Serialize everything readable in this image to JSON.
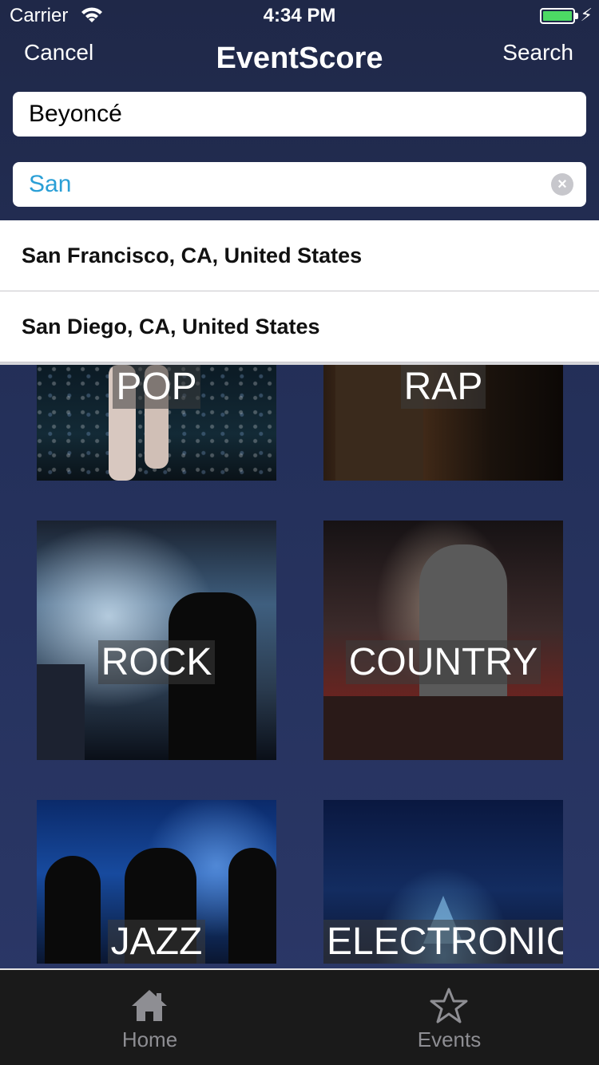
{
  "status_bar": {
    "carrier": "Carrier",
    "time": "4:34 PM",
    "battery_color": "#4cd964"
  },
  "nav": {
    "cancel_label": "Cancel",
    "title": "EventScore",
    "search_label": "Search"
  },
  "search": {
    "artist_value": "Beyoncé",
    "location_value": "San",
    "location_text_color": "#2a9fd6"
  },
  "suggestions": [
    {
      "label": "San Francisco, CA, United States"
    },
    {
      "label": "San Diego, CA, United States"
    }
  ],
  "genres": [
    {
      "label": "POP"
    },
    {
      "label": "RAP"
    },
    {
      "label": "ROCK"
    },
    {
      "label": "COUNTRY"
    },
    {
      "label": "JAZZ"
    },
    {
      "label": "ELECTRONIC"
    }
  ],
  "tab_bar": {
    "items": [
      {
        "label": "Home",
        "icon": "home-icon"
      },
      {
        "label": "Events",
        "icon": "star-icon"
      }
    ]
  }
}
